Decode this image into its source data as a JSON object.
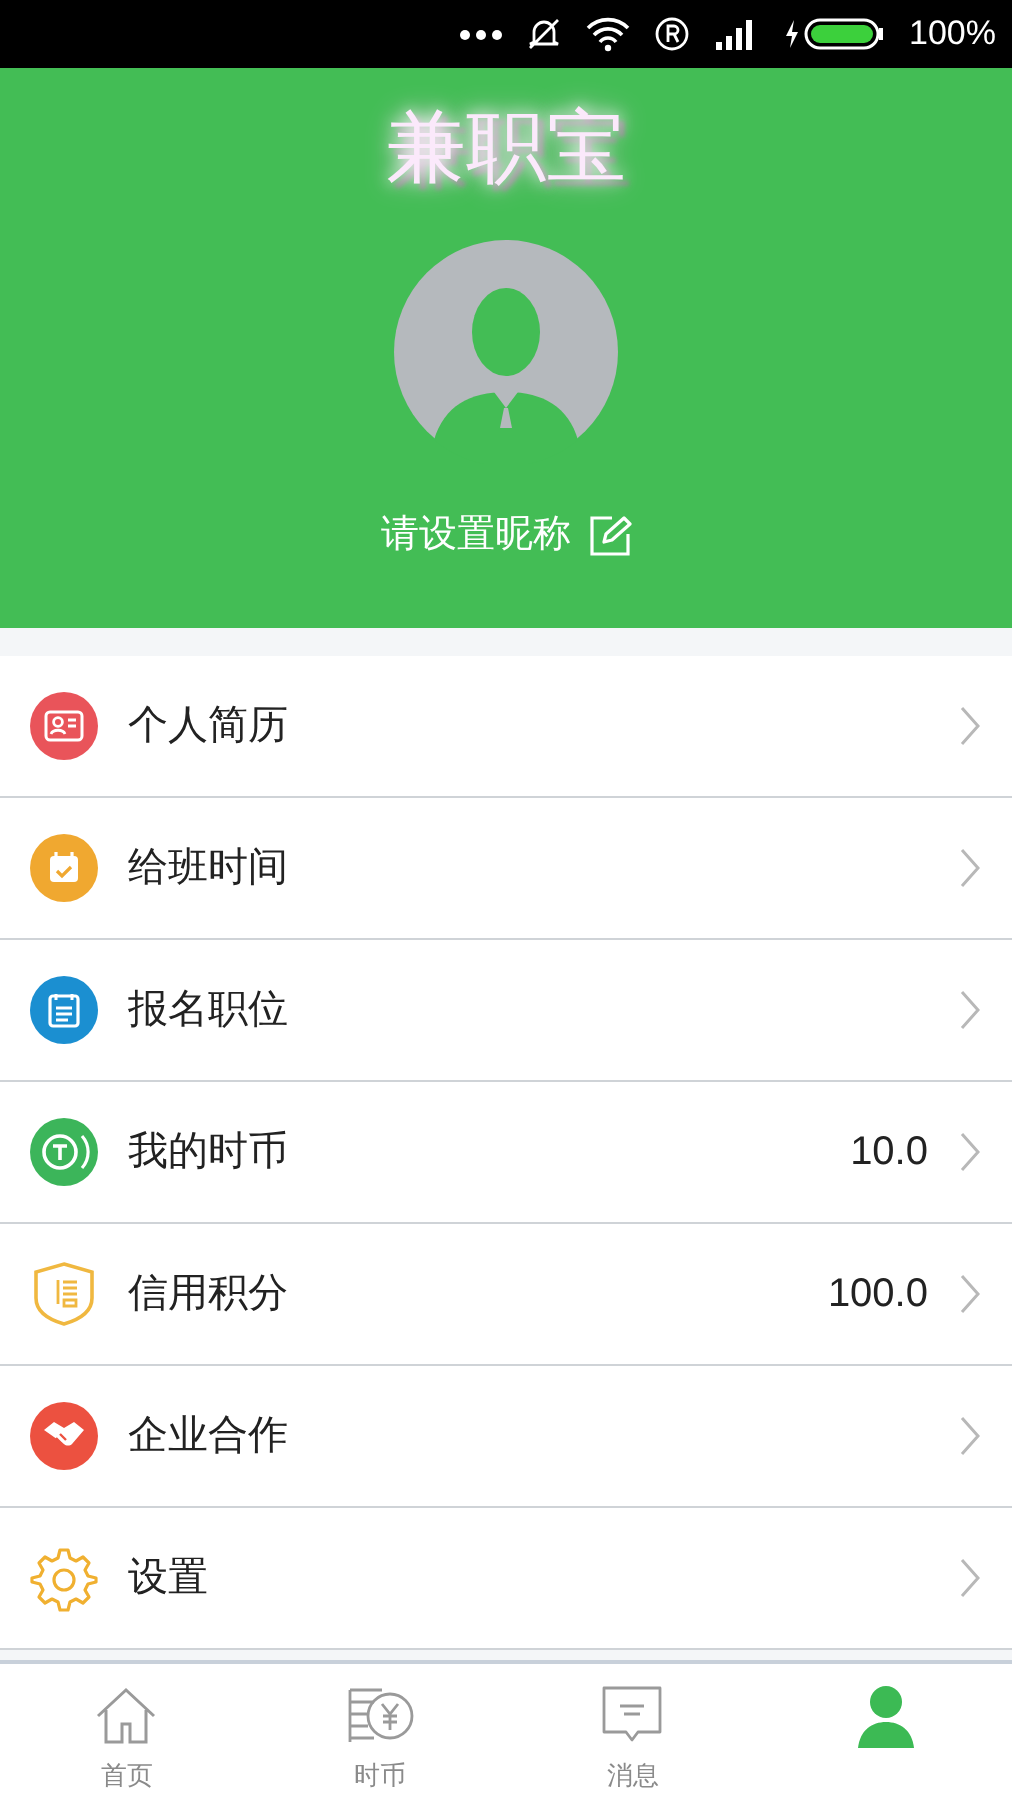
{
  "status_bar": {
    "battery": "100%"
  },
  "header": {
    "app_title": "兼职宝",
    "nickname": "请设置昵称"
  },
  "menu": [
    {
      "kind": "resume",
      "label": "个人简历"
    },
    {
      "kind": "schedule",
      "label": "给班时间"
    },
    {
      "kind": "apply",
      "label": "报名职位"
    },
    {
      "kind": "coin",
      "label": "我的时币",
      "value": "10.0"
    },
    {
      "kind": "credit",
      "label": "信用积分",
      "value": "100.0"
    },
    {
      "kind": "partner",
      "label": "企业合作"
    },
    {
      "kind": "settings",
      "label": "设置"
    }
  ],
  "tab_bar": [
    {
      "kind": "home",
      "label": "首页",
      "selected": false
    },
    {
      "kind": "coins",
      "label": "时币",
      "selected": false
    },
    {
      "kind": "messages",
      "label": "消息",
      "selected": false
    },
    {
      "kind": "profile",
      "selected": true
    }
  ]
}
